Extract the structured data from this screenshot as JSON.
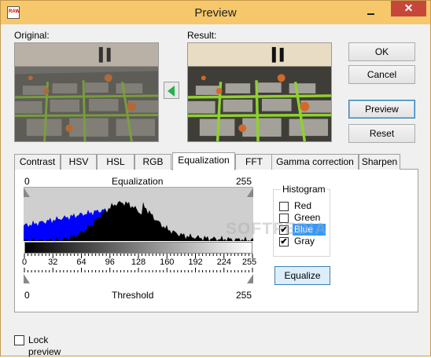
{
  "window": {
    "title": "Preview",
    "icon": "raw-file-icon",
    "icon_text": "RAW",
    "close_glyph": "✕"
  },
  "images": {
    "original_label": "Original:",
    "result_label": "Result:"
  },
  "buttons": {
    "ok": "OK",
    "cancel": "Cancel",
    "preview": "Preview",
    "reset": "Reset"
  },
  "tabs": [
    {
      "label": "Contrast",
      "active": false
    },
    {
      "label": "HSV",
      "active": false
    },
    {
      "label": "HSL",
      "active": false
    },
    {
      "label": "RGB",
      "active": false
    },
    {
      "label": "Equalization",
      "active": true
    },
    {
      "label": "FFT",
      "active": false
    },
    {
      "label": "Gamma correction",
      "active": false
    },
    {
      "label": "Sharpen",
      "active": false
    }
  ],
  "equalization": {
    "top_min": "0",
    "top_title": "Equalization",
    "top_max": "255",
    "ticks": [
      "0",
      "32",
      "64",
      "96",
      "128",
      "160",
      "192",
      "224",
      "255"
    ],
    "bottom_min": "0",
    "bottom_title": "Threshold",
    "bottom_max": "255",
    "range_min": 0,
    "range_max": 255
  },
  "histogram": {
    "group_title": "Histogram",
    "channels": [
      {
        "label": "Red",
        "checked": false,
        "selected": false
      },
      {
        "label": "Green",
        "checked": false,
        "selected": false
      },
      {
        "label": "Blue",
        "checked": true,
        "selected": true
      },
      {
        "label": "Gray",
        "checked": true,
        "selected": false
      }
    ],
    "equalize_label": "Equalize",
    "blue_color": "#0000ff",
    "gray_color": "#000000"
  },
  "lock_preview": {
    "label": "Lock preview",
    "checked": false
  },
  "watermark": "SOFTPEDIA",
  "colors": {
    "title_bar": "#f6c86b",
    "close": "#c7463a",
    "accent": "#3399ff",
    "arrow": "#24b24b"
  }
}
